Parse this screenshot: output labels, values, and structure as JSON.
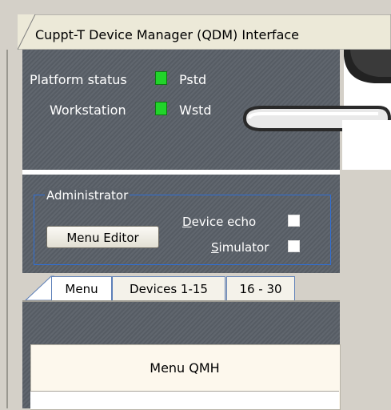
{
  "window": {
    "title": "Cuppt-T Device Manager (QDM) Interface"
  },
  "status": {
    "platform": {
      "label": "Platform status",
      "value": "Pstd",
      "led_color": "#21d42a"
    },
    "workstation": {
      "label": "Workstation",
      "value": "Wstd",
      "led_color": "#21d42a"
    }
  },
  "admin": {
    "legend": "Administrator",
    "menu_editor_label": "Menu Editor",
    "device_echo": {
      "label_prefix": "",
      "label_underlined": "D",
      "label_rest": "evice echo",
      "checked": false
    },
    "simulator": {
      "label_prefix": "",
      "label_underlined": "S",
      "label_rest": "imulator",
      "checked": false
    }
  },
  "tabs": [
    {
      "label": "Menu",
      "active": true
    },
    {
      "label": "Devices 1-15",
      "active": false
    },
    {
      "label": "16 - 30",
      "active": false
    }
  ],
  "menu_panel": {
    "title": "Menu QMH"
  },
  "colors": {
    "panel": "#5a6068",
    "group_border": "#2f6fd6",
    "chrome": "#d4d0c8"
  }
}
